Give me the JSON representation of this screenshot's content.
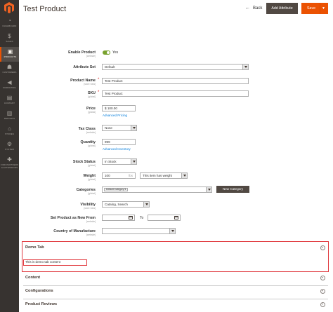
{
  "menu": [
    {
      "icon": "dashboard-icon",
      "glyph": "◔",
      "label": "DASHBOARD"
    },
    {
      "icon": "dollar-icon",
      "glyph": "$",
      "label": "SALES"
    },
    {
      "icon": "cube-icon",
      "glyph": "▣",
      "label": "PRODUCTS"
    },
    {
      "icon": "person-icon",
      "glyph": "☗",
      "label": "CUSTOMERS"
    },
    {
      "icon": "megaphone-icon",
      "glyph": "◀",
      "label": "MARKETING"
    },
    {
      "icon": "content-icon",
      "glyph": "▤",
      "label": "CONTENT"
    },
    {
      "icon": "bar-chart-icon",
      "glyph": "▥",
      "label": "REPORTS"
    },
    {
      "icon": "store-icon",
      "glyph": "⌂",
      "label": "STORES"
    },
    {
      "icon": "gear-icon",
      "glyph": "⚙",
      "label": "SYSTEM"
    },
    {
      "icon": "puzzle-icon",
      "glyph": "✚",
      "label": "FIND PARTNERS & EXTENSIONS"
    }
  ],
  "header": {
    "title": "Test Product",
    "back": "Back",
    "add_attribute": "Add Attribute",
    "save": "Save"
  },
  "form": {
    "enable_label": "Enable Product",
    "enable_scope": "[website]",
    "enable_value": "Yes",
    "attrset_label": "Attribute Set",
    "attrset_value": "Default",
    "name_label": "Product Name",
    "name_scope": "[store view]",
    "name_value": "Test Product",
    "sku_label": "SKU",
    "sku_scope": "[global]",
    "sku_value": "Test Product",
    "price_label": "Price",
    "price_scope": "[global]",
    "price_value": "$ 100.00",
    "advanced_pricing": "Advanced Pricing",
    "tax_label": "Tax Class",
    "tax_scope": "[website]",
    "tax_value": "None",
    "qty_label": "Quantity",
    "qty_scope": "[global]",
    "qty_value": "999",
    "advanced_inventory": "Advanced Inventory",
    "stock_label": "Stock Status",
    "stock_scope": "[global]",
    "stock_value": "In Stock",
    "weight_label": "Weight",
    "weight_scope": "[global]",
    "weight_value": "100",
    "weight_unit": "lbs",
    "weight_type": "This item has weight",
    "cat_label": "Categories",
    "cat_scope": "[global]",
    "cat_chip": "Default Category",
    "new_category": "New Category",
    "vis_label": "Visibility",
    "vis_scope": "[store view]",
    "vis_value": "Catalog, Search",
    "new_label": "Set Product as New From",
    "new_scope": "[website]",
    "new_to": "To",
    "country_label": "Country of Manufacture",
    "country_scope": "[website]"
  },
  "sections": {
    "demo_title": "Demo Tab",
    "demo_content": "This is demo tab content",
    "content": "Content",
    "configurations": "Configurations",
    "reviews": "Product Reviews"
  }
}
